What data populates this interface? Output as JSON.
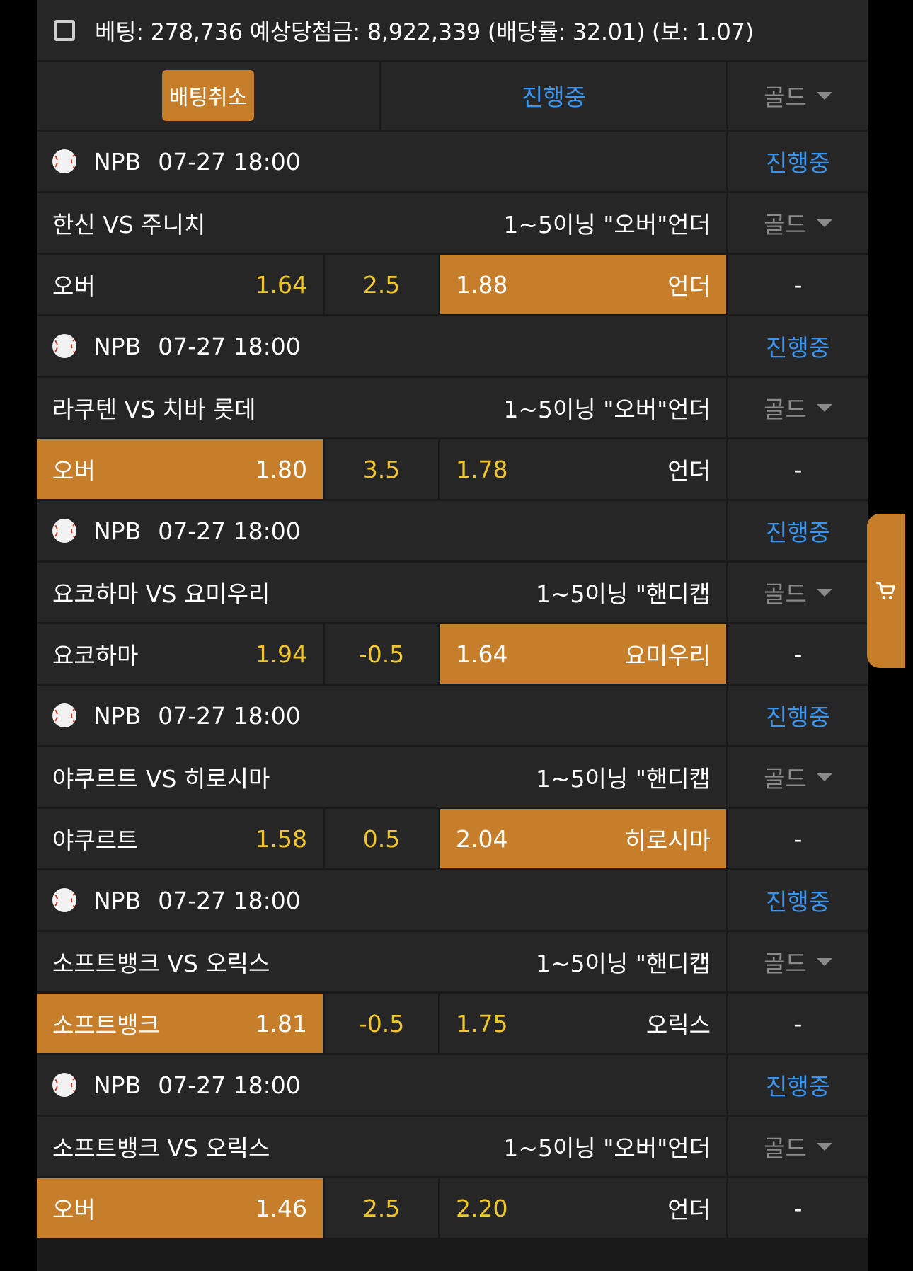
{
  "summary": {
    "text": "베팅: 278,736 예상당첨금: 8,922,339 (배당률: 32.01) (보: 1.07)"
  },
  "actions": {
    "cancel_label": "배팅취소",
    "status_label": "진행중",
    "grade_label": "골드"
  },
  "games": [
    {
      "league": "NPB",
      "datetime": "07-27 18:00",
      "status": "진행중",
      "matchup": "한신 VS 주니치",
      "market": "1~5이닝 \"오버\"언더",
      "grade": "골드",
      "home_label": "오버",
      "home_odds": "1.64",
      "line": "2.5",
      "away_odds": "1.88",
      "away_label": "언더",
      "result": "-",
      "selected": "away"
    },
    {
      "league": "NPB",
      "datetime": "07-27 18:00",
      "status": "진행중",
      "matchup": "라쿠텐 VS 치바 롯데",
      "market": "1~5이닝 \"오버\"언더",
      "grade": "골드",
      "home_label": "오버",
      "home_odds": "1.80",
      "line": "3.5",
      "away_odds": "1.78",
      "away_label": "언더",
      "result": "-",
      "selected": "home"
    },
    {
      "league": "NPB",
      "datetime": "07-27 18:00",
      "status": "진행중",
      "matchup": "요코하마 VS 요미우리",
      "market": "1~5이닝 \"핸디캡",
      "grade": "골드",
      "home_label": "요코하마",
      "home_odds": "1.94",
      "line": "-0.5",
      "away_odds": "1.64",
      "away_label": "요미우리",
      "result": "-",
      "selected": "away"
    },
    {
      "league": "NPB",
      "datetime": "07-27 18:00",
      "status": "진행중",
      "matchup": "야쿠르트 VS 히로시마",
      "market": "1~5이닝 \"핸디캡",
      "grade": "골드",
      "home_label": "야쿠르트",
      "home_odds": "1.58",
      "line": "0.5",
      "away_odds": "2.04",
      "away_label": "히로시마",
      "result": "-",
      "selected": "away"
    },
    {
      "league": "NPB",
      "datetime": "07-27 18:00",
      "status": "진행중",
      "matchup": "소프트뱅크 VS 오릭스",
      "market": "1~5이닝 \"핸디캡",
      "grade": "골드",
      "home_label": "소프트뱅크",
      "home_odds": "1.81",
      "line": "-0.5",
      "away_odds": "1.75",
      "away_label": "오릭스",
      "result": "-",
      "selected": "home"
    },
    {
      "league": "NPB",
      "datetime": "07-27 18:00",
      "status": "진행중",
      "matchup": "소프트뱅크 VS 오릭스",
      "market": "1~5이닝 \"오버\"언더",
      "grade": "골드",
      "home_label": "오버",
      "home_odds": "1.46",
      "line": "2.5",
      "away_odds": "2.20",
      "away_label": "언더",
      "result": "-",
      "selected": "home"
    }
  ],
  "icons": {
    "sport": "baseball-icon",
    "dropdown": "caret-down-icon",
    "cart": "cart-icon",
    "checkbox": "checkbox-icon"
  },
  "colors": {
    "accent": "#c67e2a",
    "status": "#3a95f0",
    "odds": "#f0c62c",
    "muted": "#8a8a8a",
    "cell": "#262626"
  }
}
